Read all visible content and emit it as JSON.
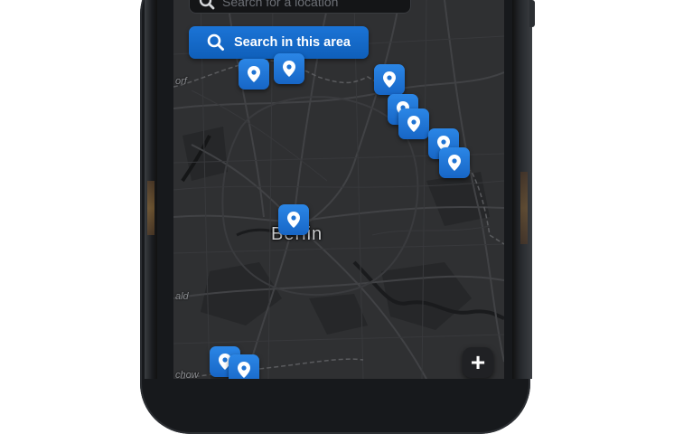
{
  "search": {
    "placeholder": "Search for a location",
    "search_area_label": "Search in this area"
  },
  "map": {
    "city_label": "Berlin",
    "place_labels": [
      "orf",
      "ald",
      "chow"
    ]
  },
  "fab": {
    "label": "+"
  },
  "pins": [
    {
      "icon": "location-pin-icon"
    },
    {
      "icon": "location-pin-icon"
    },
    {
      "icon": "location-pin-icon"
    },
    {
      "icon": "location-pin-icon"
    },
    {
      "icon": "location-pin-icon"
    },
    {
      "icon": "location-pin-icon"
    },
    {
      "icon": "location-pin-icon"
    },
    {
      "icon": "location-pin-icon"
    },
    {
      "icon": "location-pin-icon"
    },
    {
      "icon": "location-pin-icon"
    },
    {
      "icon": "location-pin-icon"
    }
  ],
  "colors": {
    "map_background": "#2f3032",
    "accent_blue": "#1766c6",
    "search_field_bg": "#141517"
  }
}
